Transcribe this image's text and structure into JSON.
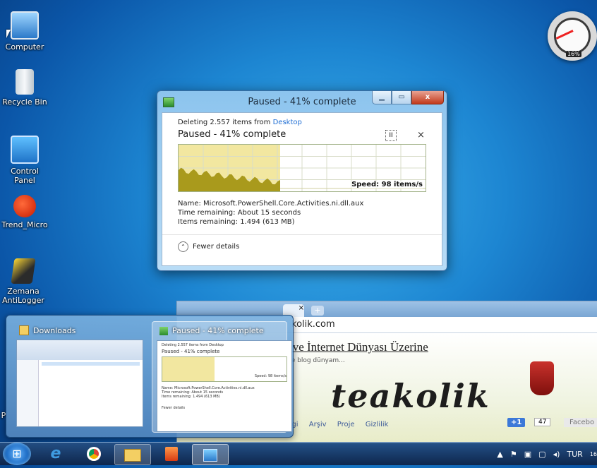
{
  "desktop": {
    "icons": [
      {
        "label": "Computer"
      },
      {
        "label": "Recycle Bin"
      },
      {
        "label": "Control Panel"
      },
      {
        "label": "Trend_Micro"
      },
      {
        "label": "Zemana AntiLogger"
      }
    ],
    "partial_label": "P",
    "gauge_percent": "16%"
  },
  "browser": {
    "url": "kolik.com",
    "headline": "ji ve İnternet Dünyası Üzerine",
    "subtitle": "t ve blog dünyam...",
    "logo": "teakolik",
    "nav": [
      "Bilgi",
      "Arşiv",
      "Proje",
      "Gizlilik"
    ],
    "plus_one": "+1",
    "plus_one_count": "47",
    "facebook": "Facebo"
  },
  "dialog": {
    "title": "Paused - 41% complete",
    "deleting_prefix": "Deleting 2.557 items from",
    "source": "Desktop",
    "status": "Paused - 41% complete",
    "speed": "Speed: 98 items/s",
    "progress": 0.41,
    "name_line": "Name:  Microsoft.PowerShell.Core.Activities.ni.dll.aux",
    "time_line": "Time remaining:  About 15 seconds",
    "items_line": "Items remaining:  1.494 (613 MB)",
    "fewer_details": "Fewer details",
    "controls": {
      "minimize": "▁",
      "maximize": "▭",
      "close": "x",
      "pause": "II",
      "cancel": "×"
    }
  },
  "peek": {
    "downloads_label": "Downloads",
    "progress_label": "Paused - 41% complete",
    "mini": {
      "deleting": "Deleting 2.557 items from Desktop",
      "status": "Paused - 41% complete",
      "name": "Name: Microsoft.PowerShell.Core.Activities.ni.dll.aux",
      "time": "Time remaining: About 15 seconds",
      "items": "Items remaining: 1.494 (613 MB)",
      "fewer": "Fewer details",
      "speed": "Speed: 98 items/s"
    }
  },
  "taskbar": {
    "language": "TUR",
    "clock": "16"
  }
}
